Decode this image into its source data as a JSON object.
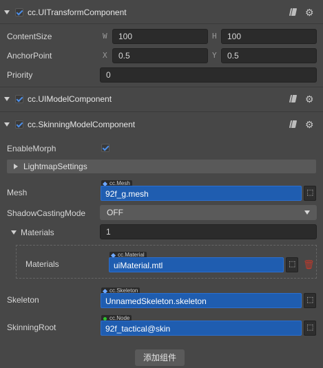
{
  "components": {
    "ui_transform": {
      "title": "cc.UITransformComponent",
      "content_size": {
        "label": "ContentSize",
        "w_axis": "W",
        "w_value": "100",
        "h_axis": "H",
        "h_value": "100"
      },
      "anchor_point": {
        "label": "AnchorPoint",
        "x_axis": "X",
        "x_value": "0.5",
        "y_axis": "Y",
        "y_value": "0.5"
      },
      "priority": {
        "label": "Priority",
        "value": "0"
      }
    },
    "ui_model": {
      "title": "cc.UIModelComponent"
    },
    "skinning_model": {
      "title": "cc.SkinningModelComponent",
      "enable_morph": {
        "label": "EnableMorph",
        "checked": true
      },
      "lightmap_settings": {
        "label": "LightmapSettings"
      },
      "mesh": {
        "label": "Mesh",
        "type_tag": "cc.Mesh",
        "value": "92f_g.mesh"
      },
      "shadow_casting_mode": {
        "label": "ShadowCastingMode",
        "value": "OFF"
      },
      "materials": {
        "label": "Materials",
        "count": "1",
        "item_label": "Materials",
        "item_type_tag": "cc.Material",
        "item_value": "uiMaterial.mtl"
      },
      "skeleton": {
        "label": "Skeleton",
        "type_tag": "cc.Skeleton",
        "value": "UnnamedSkeleton.skeleton"
      },
      "skinning_root": {
        "label": "SkinningRoot",
        "type_tag": "cc.Node",
        "value": "92f_tactical@skin"
      }
    }
  },
  "add_component_button": "添加组件",
  "colors": {
    "accent": "#1f5db0",
    "background": "#474747",
    "delete": "#c0392b"
  }
}
